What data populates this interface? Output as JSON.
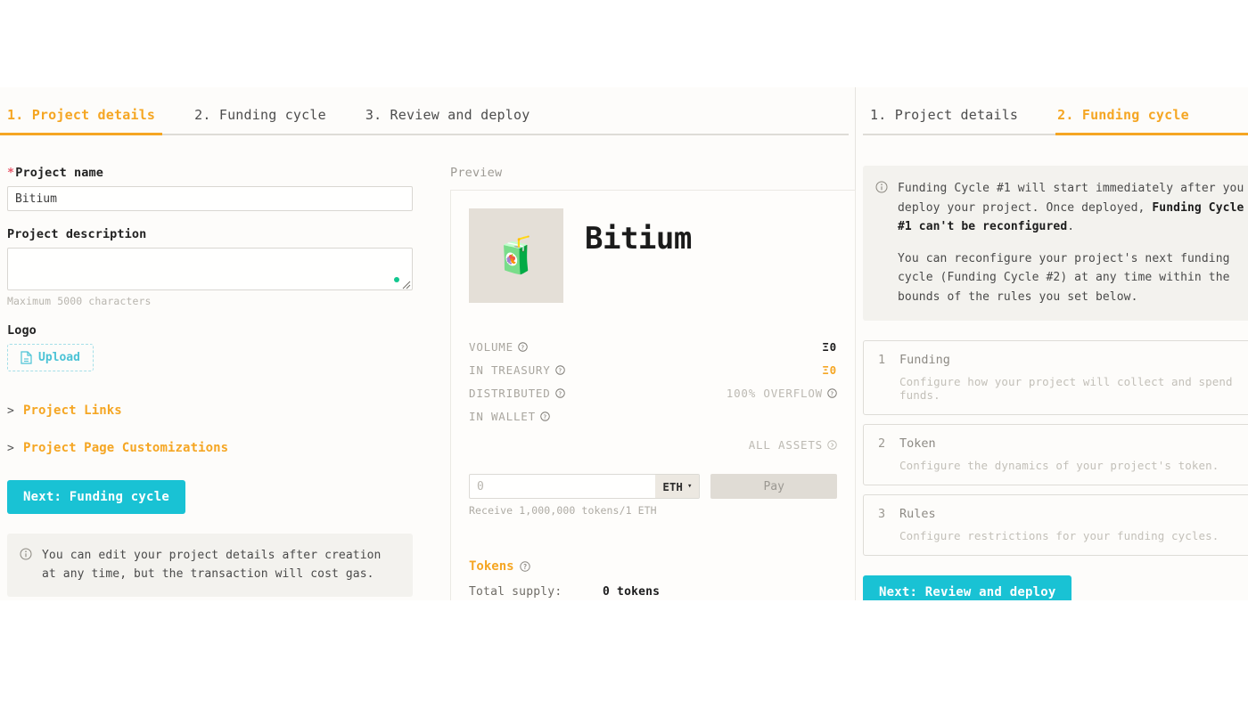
{
  "left_panel": {
    "steps": [
      {
        "label": "1. Project details",
        "active": true
      },
      {
        "label": "2. Funding cycle",
        "active": false
      },
      {
        "label": "3. Review and deploy",
        "active": false
      }
    ],
    "form": {
      "project_name_label": "Project name",
      "project_name_required_mark": "*",
      "project_name_value": "Bitium",
      "project_name_placeholder": "",
      "project_description_label": "Project description",
      "project_description_value": "",
      "project_description_placeholder": "",
      "description_hint": "Maximum 5000 characters",
      "logo_label": "Logo",
      "upload_label": "Upload",
      "upload_icon": "document-icon",
      "accordions": [
        {
          "label": "Project Links",
          "chevron": ">"
        },
        {
          "label": "Project Page Customizations",
          "chevron": ">"
        }
      ],
      "next_button": "Next: Funding cycle",
      "info_icon": "info-circle-icon",
      "info_text": "You can edit your project details after creation at any time, but the transaction will cost gas."
    },
    "preview": {
      "title": "Preview",
      "logo_emoji": "🧃",
      "project_name": "Bitium",
      "stats": [
        {
          "label": "VOLUME",
          "help": true,
          "value": "Ξ0",
          "style": "dark"
        },
        {
          "label": "IN TREASURY",
          "help": true,
          "value": "Ξ0",
          "style": "orange"
        },
        {
          "label": "DISTRIBUTED",
          "help": true,
          "value": "100% OVERFLOW",
          "value_help": true,
          "style": "muted"
        },
        {
          "label": "IN WALLET",
          "help": true,
          "value": "",
          "style": "muted"
        }
      ],
      "all_assets_label": "ALL ASSETS",
      "all_assets_icon": "chevron-right-circle-icon",
      "pay": {
        "amount_placeholder": "0",
        "amount_value": "",
        "currency": "ETH",
        "currency_caret": "▾",
        "pay_button": "Pay",
        "receive_hint": "Receive 1,000,000 tokens/1 ETH"
      },
      "tokens": {
        "heading": "Tokens",
        "help": true,
        "total_supply_label": "Total supply:",
        "total_supply_value": "0 tokens"
      }
    }
  },
  "right_panel": {
    "steps": [
      {
        "label": "1. Project details",
        "active": false
      },
      {
        "label": "2. Funding cycle",
        "active": true
      }
    ],
    "info_icon": "info-circle-icon",
    "info_paragraph_1_a": "Funding Cycle #1 will start immediately after you deploy your project. Once deployed, ",
    "info_paragraph_1_bold": "Funding Cycle #1 can't be reconfigured",
    "info_paragraph_1_b": ".",
    "info_paragraph_2": "You can reconfigure your project's next funding cycle (Funding Cycle #2) at any time within the bounds of the rules you set below.",
    "cards": [
      {
        "number": "1",
        "title": "Funding",
        "description": "Configure how your project will collect and spend funds."
      },
      {
        "number": "2",
        "title": "Token",
        "description": "Configure the dynamics of your project's token."
      },
      {
        "number": "3",
        "title": "Rules",
        "description": "Configure restrictions for your funding cycles."
      }
    ],
    "next_button": "Next: Review and deploy"
  },
  "colors": {
    "accent_orange": "#f5a623",
    "accent_teal": "#19c2d4",
    "required_red": "#e8586b",
    "info_bg": "#f3f2ee",
    "page_bg": "#fdfcfa",
    "textarea_dot_green": "#12c78f"
  }
}
